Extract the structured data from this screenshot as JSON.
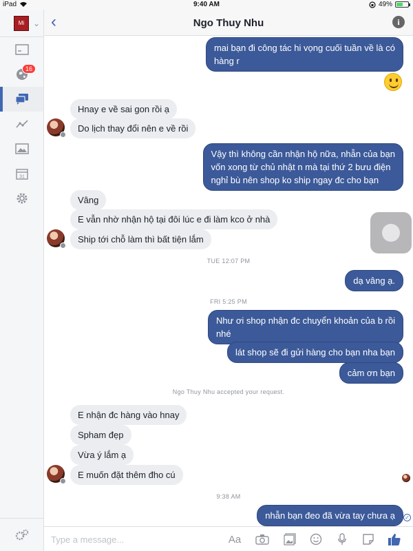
{
  "status": {
    "device": "iPad",
    "time": "9:40 AM",
    "battery": "49%",
    "battery_level": 0.49
  },
  "sidebar": {
    "page_logo_text": "Mi",
    "notifications_badge": "16",
    "items": [
      "inbox-icon",
      "globe-icon",
      "messages-icon",
      "insights-icon",
      "photos-icon",
      "calendar-icon",
      "settings-icon"
    ],
    "calendar_day": "31"
  },
  "header": {
    "title": "Ngo Thuy Nhu",
    "back": "‹",
    "info": "i"
  },
  "messages": [
    {
      "text": "mai bạn đi công tác hi vọng cuối tuần về là có\nhàng r"
    },
    {
      "text": "Hnay e về sai gon rồi ạ"
    },
    {
      "text": "Do lịch thay đổi nên e về rồi"
    },
    {
      "text": "Vậy thì không cần nhận hộ nữa, nhẫn của bạn\nvốn xong từ chủ nhật n mà tại thứ 2 bưu điện\nnghỉ bù nên shop ko ship ngay đc cho bạn"
    },
    {
      "text": "Vâng"
    },
    {
      "text": "E vẫn nhờ nhận hộ tại đôi lúc e đi làm kco ở nhà"
    },
    {
      "text": "Ship tới chỗ làm thì bất tiện lắm"
    },
    {
      "text": "dạ vâng ạ."
    },
    {
      "text": "Như ơi shop nhận đc chuyển khoản của b rồi\nnhé"
    },
    {
      "text": "lát shop sẽ đi gửi hàng cho bạn nha bạn"
    },
    {
      "text": "cảm ơn bạn"
    },
    {
      "text": "E nhận đc hàng vào hnay"
    },
    {
      "text": "Spham đẹp"
    },
    {
      "text": "Vừa ý lắm ạ"
    },
    {
      "text": "E muốn đặt thêm đho cú"
    },
    {
      "text": "nhẫn bạn đeo đã vừa tay chưa ạ"
    }
  ],
  "stamps": [
    "TUE 12:07 PM",
    "FRI 5:25 PM",
    "Ngo Thuy Nhu accepted your request.",
    "9:38 AM"
  ],
  "composer": {
    "placeholder": "Type a message...",
    "text_format_label": "Aa",
    "tools": [
      "camera-icon",
      "gallery-icon",
      "emoji-icon",
      "microphone-icon",
      "sticker-icon",
      "like-icon"
    ]
  },
  "colors": {
    "accent": "#4267b2",
    "outgoing_bubble": "#3c5a99",
    "incoming_bubble": "#ebedf0",
    "badge": "#fa3e3e"
  }
}
